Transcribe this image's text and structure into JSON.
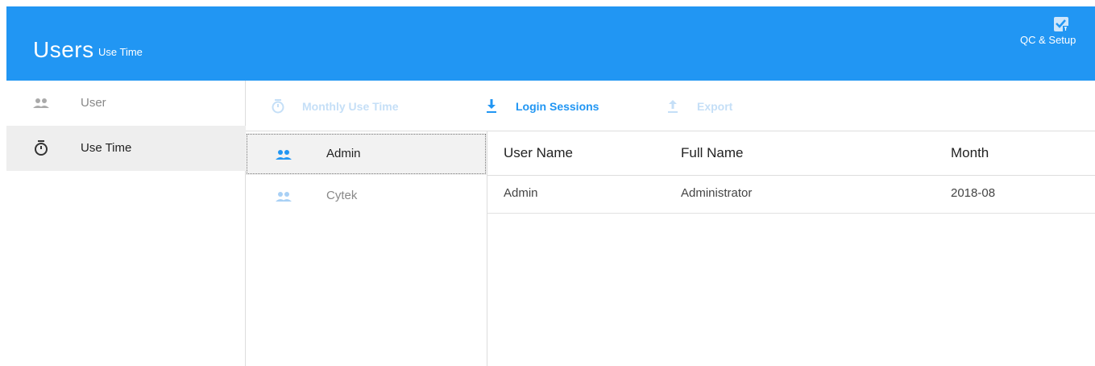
{
  "header": {
    "title": "Users",
    "subtitle": "Use Time",
    "qc_label": "QC & Setup"
  },
  "sidebar": {
    "items": [
      {
        "label": "User",
        "icon": "users-icon"
      },
      {
        "label": "Use Time",
        "icon": "stopwatch-icon"
      }
    ]
  },
  "toolbar": {
    "monthly_label": "Monthly Use Time",
    "login_label": "Login Sessions",
    "export_label": "Export"
  },
  "userlist": [
    {
      "label": "Admin"
    },
    {
      "label": "Cytek"
    }
  ],
  "table": {
    "columns": [
      "User Name",
      "Full Name",
      "Month"
    ],
    "rows": [
      [
        "Admin",
        "Administrator",
        "2018-08"
      ]
    ]
  },
  "colors": {
    "accent": "#2196f3",
    "disabled": "#c5dff7",
    "selected_bg": "#eeeeee"
  }
}
